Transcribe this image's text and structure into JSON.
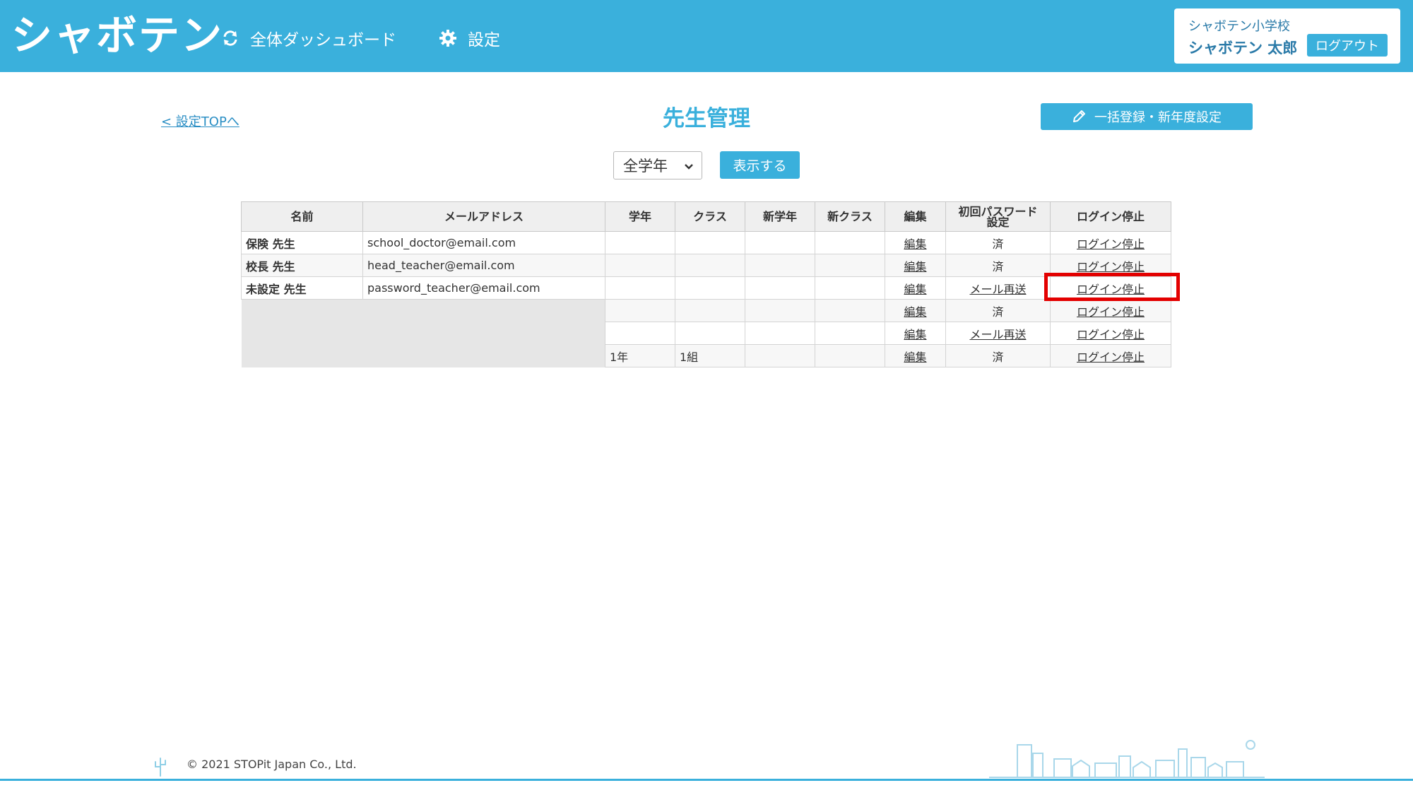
{
  "app": {
    "logo": "シャボテン",
    "nav": {
      "dashboard_label": "全体ダッシュボード",
      "settings_label": "設定"
    },
    "user": {
      "school": "シャボテン小学校",
      "name": "シャボテン 太郎",
      "logout_label": "ログアウト"
    }
  },
  "page": {
    "back_link": "< 設定TOPへ",
    "title": "先生管理",
    "bulk_button": "一括登録・新年度設定"
  },
  "filter": {
    "grade_selected": "全学年",
    "show_button": "表示する"
  },
  "table": {
    "headers": {
      "name": "名前",
      "email": "メールアドレス",
      "grade": "学年",
      "class": "クラス",
      "new_grade": "新学年",
      "new_class": "新クラス",
      "edit": "編集",
      "pw_line1": "初回パスワード",
      "pw_line2": "設定",
      "login_stop": "ログイン停止"
    },
    "rows": [
      {
        "name": "保険 先生",
        "email": "school_doctor@email.com",
        "grade": "",
        "class": "",
        "new_grade": "",
        "new_class": "",
        "edit": "編集",
        "password": "済",
        "login_stop": "ログイン停止"
      },
      {
        "name": "校長 先生",
        "email": "head_teacher@email.com",
        "grade": "",
        "class": "",
        "new_grade": "",
        "new_class": "",
        "edit": "編集",
        "password": "済",
        "login_stop": "ログイン停止"
      },
      {
        "name": "未設定 先生",
        "email": "password_teacher@email.com",
        "grade": "",
        "class": "",
        "new_grade": "",
        "new_class": "",
        "edit": "編集",
        "password": "メール再送",
        "login_stop": "ログイン停止"
      },
      {
        "grade": "",
        "class": "",
        "new_grade": "",
        "new_class": "",
        "edit": "編集",
        "password": "済",
        "login_stop": "ログイン停止"
      },
      {
        "grade": "",
        "class": "",
        "new_grade": "",
        "new_class": "",
        "edit": "編集",
        "password": "メール再送",
        "login_stop": "ログイン停止"
      },
      {
        "grade": "1年",
        "class": "1組",
        "new_grade": "",
        "new_class": "",
        "edit": "編集",
        "password": "済",
        "login_stop": "ログイン停止"
      }
    ]
  },
  "footer": {
    "copyright": "© 2021 STOPit Japan Co., Ltd."
  },
  "colors": {
    "brand": "#3ab0dc",
    "highlight": "#e30000"
  }
}
